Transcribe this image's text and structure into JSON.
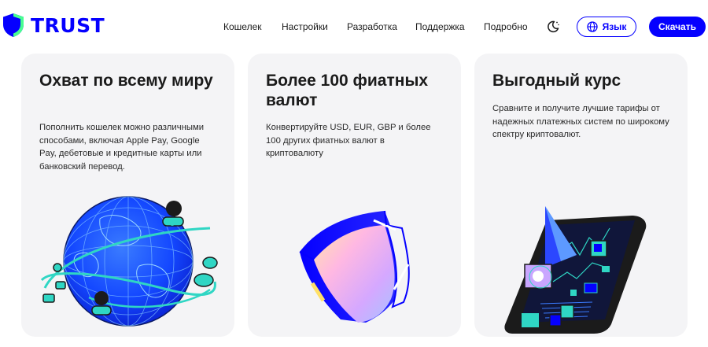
{
  "header": {
    "logo_text": "TRUST",
    "nav": [
      "Кошелек",
      "Настройки",
      "Разработка",
      "Поддержка",
      "Подробно"
    ],
    "language_label": "Язык",
    "download_label": "Скачать"
  },
  "cards": [
    {
      "title": "Охват по всему миру",
      "text": "Пополнить кошелек можно различными способами, включая Apple Pay, Google Pay, дебетовые и кредитные карты или банковский перевод.",
      "illustration": "globe-illustration"
    },
    {
      "title": "Более 100 фиатных валют",
      "text": "Конвертируйте USD, EUR, GBP и более 100 других фиатных валют в криптовалюту",
      "illustration": "shield-illustration"
    },
    {
      "title": "Выгодный курс",
      "text": "Сравните и получите лучшие тарифы от надежных платежных систем по широкому спектру криптовалют.",
      "illustration": "tablet-chart-illustration"
    }
  ],
  "colors": {
    "brand_blue": "#0500ff",
    "card_background": "#f4f4f6",
    "accent_cyan": "#2fd6c4"
  }
}
